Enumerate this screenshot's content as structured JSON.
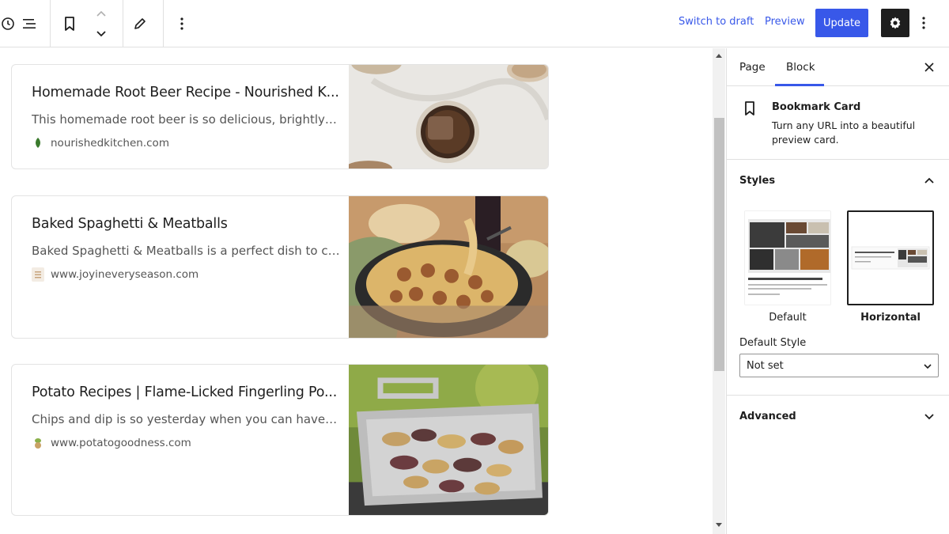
{
  "toolbar": {
    "switch_to_draft": "Switch to draft",
    "preview": "Preview",
    "update": "Update"
  },
  "cards": [
    {
      "title": "Homemade Root Beer Recipe - Nourished K...",
      "description": "This homemade root beer is so delicious, brightly fl...",
      "site": "nourishedkitchen.com"
    },
    {
      "title": "Baked Spaghetti & Meatballs",
      "description": "Baked Spaghetti & Meatballs is a perfect dish to co...",
      "site": "www.joyineveryseason.com"
    },
    {
      "title": "Potato Recipes | Flame-Licked Fingerling Po...",
      "description": "Chips and dip is so yesterday when you can have g...",
      "site": "www.potatogoodness.com"
    }
  ],
  "sidebar": {
    "tabs": [
      "Page",
      "Block"
    ],
    "active_tab": "Block",
    "block": {
      "title": "Bookmark Card",
      "description": "Turn any URL into a beautiful preview card."
    },
    "styles": {
      "heading": "Styles",
      "options": [
        "Default",
        "Horizontal"
      ],
      "selected": "Horizontal",
      "default_style_label": "Default Style",
      "default_style_value": "Not set"
    },
    "advanced": {
      "heading": "Advanced"
    }
  },
  "colors": {
    "accent": "#3858e9",
    "dark": "#1e1e1e",
    "border": "#e0e0e0"
  }
}
